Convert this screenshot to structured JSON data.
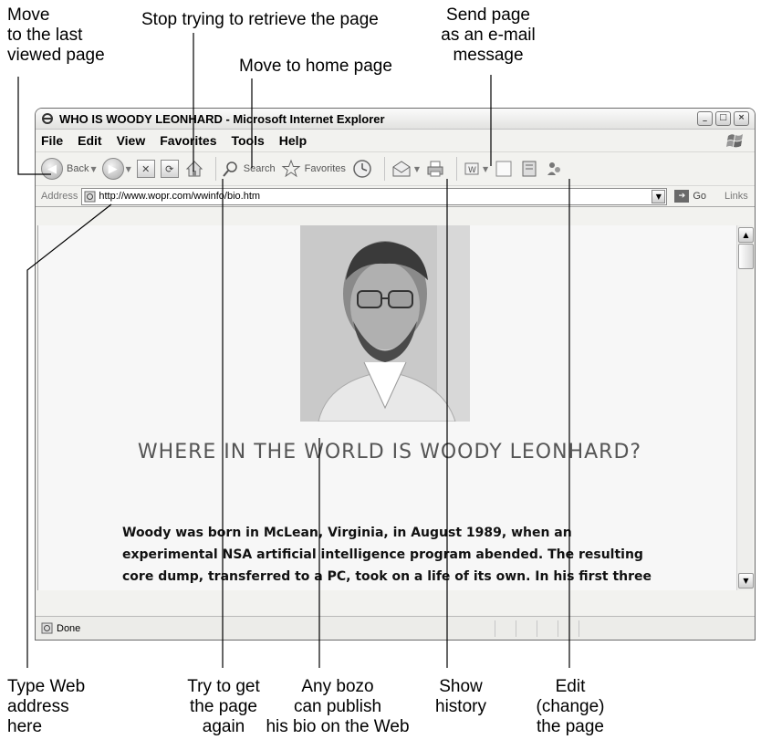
{
  "callouts": {
    "last_page": "Move\nto the last\nviewed page",
    "stop": "Stop trying to retrieve the page",
    "send_page": "Send page\nas an e-mail\nmessage",
    "home": "Move to home page",
    "address": "Type Web\naddress\nhere",
    "refresh": "Try to get\nthe page\nagain",
    "bozo": "Any bozo\ncan publish\nhis bio on the Web",
    "history": "Show\nhistory",
    "edit": "Edit\n(change)\nthe page"
  },
  "window": {
    "title": "WHO IS WOODY LEONHARD - Microsoft Internet Explorer"
  },
  "menu": [
    "File",
    "Edit",
    "View",
    "Favorites",
    "Tools",
    "Help"
  ],
  "toolbar": {
    "back_label": "Back",
    "search_label": "Search",
    "favorites_label": "Favorites"
  },
  "address": {
    "label": "Address",
    "url": "http://www.wopr.com/wwinfo/bio.htm",
    "go_label": "Go",
    "links_label": "Links"
  },
  "page": {
    "heading": "WHERE IN THE WORLD IS WOODY LEONHARD?",
    "body": "Woody was born in McLean, Virginia, in August 1989, when an experimental NSA artificial intelligence program abended. The resulting core dump, transferred to a PC, took on a life of its own. In his first three days, \"Woody\" (as the dump became known) fried six different PC"
  },
  "status": {
    "text": "Done"
  },
  "icons": {
    "ie_logo": "ie-icon",
    "windows_logo": "windows-flag-icon"
  },
  "colors": {
    "window_bg": "#f2f2ef",
    "content_bg": "#f7f7f7",
    "heading": "#555555"
  }
}
